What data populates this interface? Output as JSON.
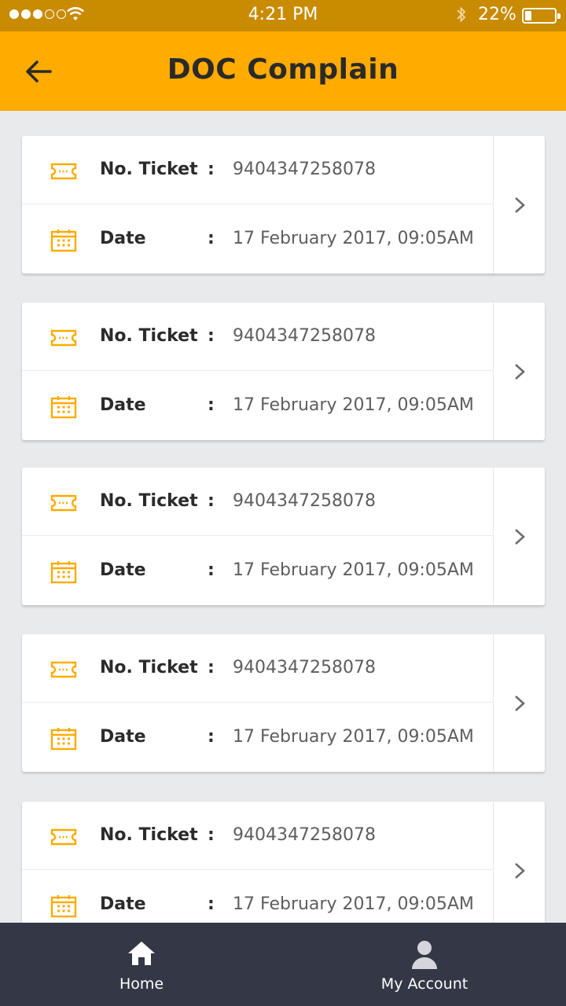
{
  "status_bar": {
    "time": "4:21 PM",
    "battery": "22%",
    "signal_filled": 3,
    "signal_total": 5
  },
  "header": {
    "title": "DOC Complain",
    "back_icon": "arrow-left-icon"
  },
  "labels": {
    "ticket": "No. Ticket",
    "date": "Date",
    "separator": ":"
  },
  "tickets": [
    {
      "ticket_no": "9404347258078",
      "date": "17 February 2017, 09:05AM"
    },
    {
      "ticket_no": "9404347258078",
      "date": "17 February 2017, 09:05AM"
    },
    {
      "ticket_no": "9404347258078",
      "date": "17 February 2017, 09:05AM"
    },
    {
      "ticket_no": "9404347258078",
      "date": "17 February 2017, 09:05AM"
    },
    {
      "ticket_no": "9404347258078",
      "date": "17 February 2017, 09:05AM"
    }
  ],
  "bottom_nav": {
    "home": "Home",
    "account": "My Account"
  },
  "colors": {
    "accent": "#ffab00",
    "status_bar": "#c98b00",
    "nav_bg": "#343846"
  }
}
